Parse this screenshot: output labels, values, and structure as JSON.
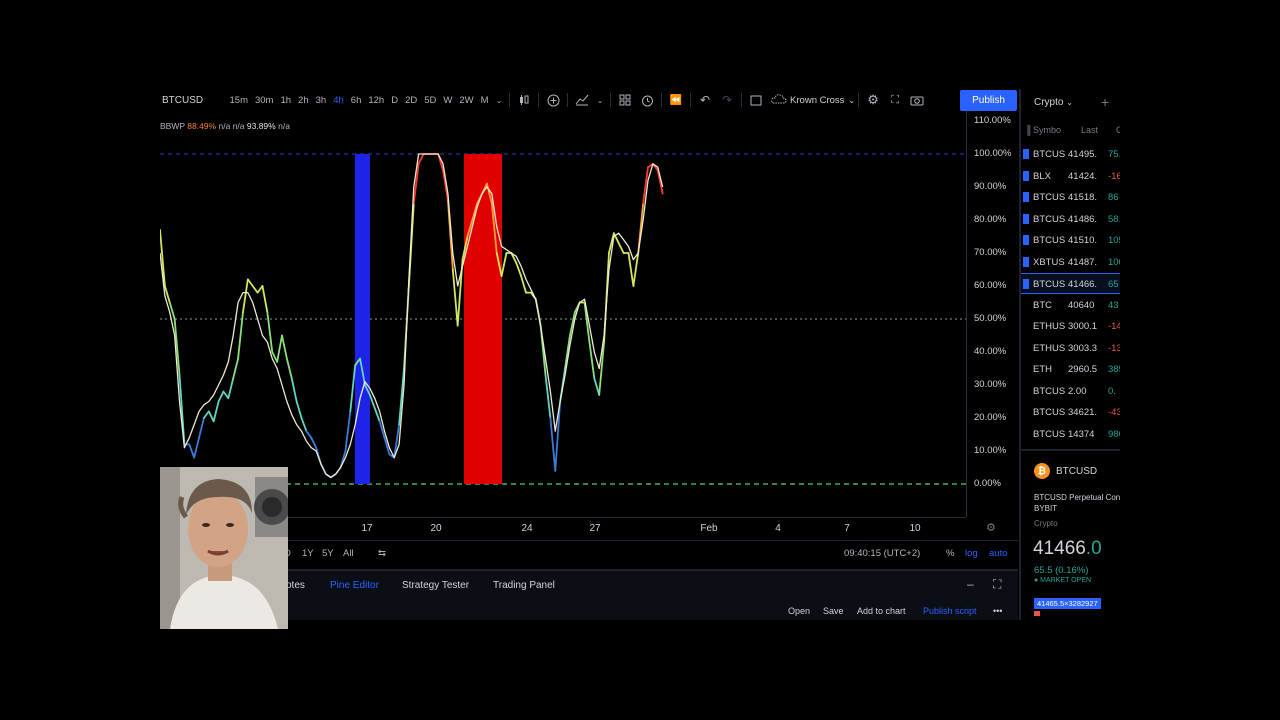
{
  "toolbar": {
    "symbol": "BTCUSD",
    "timeframes": [
      "15m",
      "30m",
      "1h",
      "2h",
      "3h",
      "4h",
      "6h",
      "12h",
      "D",
      "2D",
      "5D",
      "W",
      "2W",
      "M"
    ],
    "active_timeframe": "4h",
    "template_name": "Krown Cross",
    "publish_label": "Publish"
  },
  "legend": {
    "name": "BBWP",
    "value1": "88.49%",
    "na1": "n/a",
    "na2": "n/a",
    "value2": "93.89%",
    "na3": "n/a"
  },
  "price_axis": [
    "110.00%",
    "100.00%",
    "90.00%",
    "80.00%",
    "70.00%",
    "60.00%",
    "50.00%",
    "40.00%",
    "30.00%",
    "20.00%",
    "10.00%",
    "0.00%"
  ],
  "time_axis": [
    "17",
    "20",
    "24",
    "27",
    "Feb",
    "4",
    "7",
    "10"
  ],
  "range_bar": {
    "ranges": [
      "D",
      "1Y",
      "5Y",
      "All"
    ],
    "clock": "09:40:15 (UTC+2)",
    "percent": "%",
    "log": "log",
    "auto": "auto"
  },
  "bottom_tabs": [
    "otes",
    "Pine Editor",
    "Strategy Tester",
    "Trading Panel"
  ],
  "bottom_active": "Pine Editor",
  "bottom_actions": [
    "Open",
    "Save",
    "Add to chart",
    "Publish script"
  ],
  "watchlist": {
    "title": "Crypto",
    "columns": [
      "Symbo",
      "Last",
      "C"
    ],
    "rows": [
      {
        "symbol": "BTCUS",
        "last": "41495.",
        "change": "75.",
        "color": "#26a69a",
        "flag": true
      },
      {
        "symbol": "BLX",
        "last": "41424.",
        "change": "-16",
        "color": "#ef5350",
        "flag": true
      },
      {
        "symbol": "BTCUS",
        "last": "41518.",
        "change": "86",
        "color": "#26a69a",
        "flag": true
      },
      {
        "symbol": "BTCUS",
        "last": "41486.",
        "change": "58.",
        "color": "#26a69a",
        "flag": true
      },
      {
        "symbol": "BTCUS",
        "last": "41510.",
        "change": "105",
        "color": "#26a69a",
        "flag": true
      },
      {
        "symbol": "XBTUS",
        "last": "41487.",
        "change": "100",
        "color": "#26a69a",
        "flag": true
      },
      {
        "symbol": "BTCUS",
        "last": "41466.",
        "change": "65",
        "color": "#26a69a",
        "flag": true,
        "selected": true
      },
      {
        "symbol": "BTC",
        "last": "40640",
        "change": "43",
        "color": "#26a69a",
        "flag": false
      },
      {
        "symbol": "ETHUS",
        "last": "3000.1",
        "change": "-14",
        "color": "#ef5350",
        "flag": false
      },
      {
        "symbol": "ETHUS",
        "last": "3003.3",
        "change": "-13",
        "color": "#ef5350",
        "flag": false
      },
      {
        "symbol": "ETH",
        "last": "2960.5",
        "change": "385",
        "color": "#26a69a",
        "flag": false
      },
      {
        "symbol": "BTCUS",
        "last": "2.00",
        "change": "0.",
        "color": "#26a69a",
        "flag": false
      },
      {
        "symbol": "BTCUS",
        "last": "34621.",
        "change": "-43",
        "color": "#ef5350",
        "flag": false
      },
      {
        "symbol": "BTCUS",
        "last": "14374",
        "change": "986",
        "color": "#26a69a",
        "flag": false
      }
    ]
  },
  "detail": {
    "symbol": "BTCUSD",
    "description": "BTCUSD Perpetual Con",
    "exchange": "BYBIT",
    "category": "Crypto",
    "price_main": "41466",
    "price_tail": ".0",
    "change": "65.5 (0.16%)",
    "market_status": "● MARKET OPEN",
    "tag": "41465.5×3282927"
  },
  "colors": {
    "accent": "#2962ff",
    "up": "#26a69a",
    "down": "#ef5350",
    "low_band": "#1d24e8",
    "high_band": "#e00000",
    "bottom_line": "#4caf50"
  },
  "chart_data": {
    "type": "line",
    "ylim": [
      0,
      110
    ],
    "yticks": [
      110,
      100,
      90,
      80,
      70,
      60,
      50,
      40,
      30,
      20,
      10,
      0
    ],
    "x": [
      0,
      2,
      4,
      6,
      8,
      10,
      12,
      14,
      16,
      18,
      20,
      22,
      24,
      26,
      28,
      30,
      32,
      34,
      36,
      38,
      40,
      42,
      44,
      46,
      48,
      50,
      52,
      54,
      56,
      58,
      60,
      62,
      64,
      66,
      68,
      70,
      72,
      74,
      76,
      78,
      80,
      82,
      84,
      86,
      88,
      90,
      92,
      94,
      96,
      98,
      100,
      102,
      104,
      106,
      108,
      110,
      112,
      114,
      116,
      118,
      120,
      122,
      124,
      126,
      128,
      130,
      132,
      134,
      136,
      138,
      140,
      142,
      144,
      146,
      148,
      150,
      152,
      154,
      156,
      158,
      160,
      162,
      164,
      166,
      168,
      170,
      172,
      174,
      176,
      178,
      180,
      182,
      184,
      186,
      188,
      190,
      192,
      194,
      196,
      198,
      200,
      202,
      204,
      206,
      208,
      210,
      212,
      214,
      216,
      218,
      220,
      222,
      224,
      226,
      228,
      230,
      232,
      234,
      236,
      238,
      240,
      242,
      244,
      246,
      248,
      250,
      252,
      254,
      256,
      258,
      260,
      262,
      264,
      266,
      268,
      270,
      272,
      274,
      276,
      278,
      280,
      282,
      284,
      286,
      288,
      290,
      292,
      294,
      296,
      298,
      300,
      302,
      304,
      306,
      308,
      310,
      312,
      314,
      316,
      318,
      320,
      322,
      324,
      326,
      328,
      330,
      332,
      334
    ],
    "series": [
      {
        "values": [
          77,
          60,
          55,
          50,
          33,
          12,
          12,
          8,
          14,
          20,
          22,
          19,
          25,
          28,
          26,
          32,
          38,
          52,
          62,
          60,
          58,
          60,
          52,
          40,
          37,
          45,
          38,
          32,
          25,
          20,
          16,
          14,
          11,
          6,
          3,
          2,
          3,
          5,
          10,
          22,
          36,
          38,
          30,
          27,
          23,
          19,
          14,
          9,
          8,
          18,
          35,
          60,
          85,
          97,
          100,
          100,
          100,
          100,
          95,
          86,
          65,
          48,
          68,
          75,
          80,
          85,
          88,
          91,
          85,
          70,
          63,
          70,
          70,
          67,
          63,
          58,
          58,
          56,
          48,
          33,
          20,
          4,
          25,
          35,
          45,
          52,
          55,
          55,
          43,
          32,
          27,
          43,
          70,
          76,
          73,
          70,
          70,
          60,
          70,
          85,
          96,
          97,
          95,
          88
        ],
        "color": "#9ee66c"
      },
      {
        "values": [
          70,
          57,
          52,
          45,
          25,
          11,
          14,
          18,
          22,
          24,
          25,
          27,
          30,
          33,
          37,
          45,
          55,
          58,
          58,
          55,
          50,
          45,
          43,
          38,
          35,
          30,
          25,
          21,
          18,
          16,
          13,
          11,
          10,
          6,
          3,
          2,
          3,
          5,
          8,
          12,
          18,
          26,
          31,
          29,
          26,
          22,
          16,
          11,
          8,
          12,
          30,
          62,
          90,
          100,
          100,
          100,
          100,
          100,
          97,
          88,
          70,
          60,
          66,
          72,
          78,
          84,
          88,
          90,
          88,
          78,
          72,
          71,
          70,
          69,
          66,
          62,
          59,
          56,
          48,
          38,
          28,
          16,
          25,
          33,
          42,
          50,
          55,
          56,
          48,
          40,
          35,
          45,
          65,
          75,
          76,
          74,
          72,
          68,
          70,
          80,
          92,
          97,
          96,
          90
        ],
        "color": "#f0ead0"
      }
    ],
    "reference_lines": [
      100,
      50,
      0
    ],
    "low_band": [
      0,
      4
    ],
    "high_band": [
      0,
      7
    ]
  }
}
